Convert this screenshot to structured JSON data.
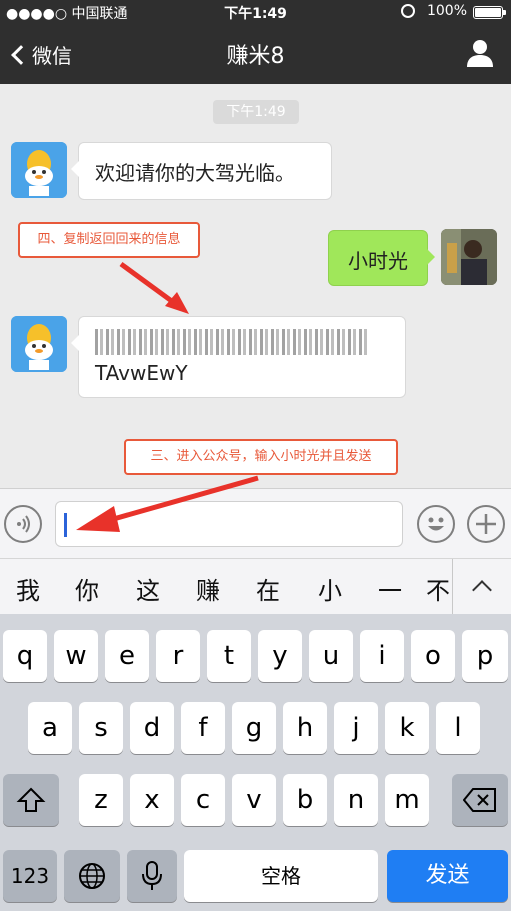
{
  "status": {
    "carrier": "●●●●○ 中国联通",
    "time": "下午1:49",
    "battery": "100%"
  },
  "nav": {
    "back_label": "微信",
    "title": "赚米8"
  },
  "chat": {
    "timestamp": "下午1:49",
    "messages": [
      {
        "from": "bot",
        "text": "欢迎请你的大驾光临。"
      },
      {
        "from": "me",
        "text": "小时光"
      },
      {
        "from": "bot",
        "line1": "TAvwEwY"
      }
    ]
  },
  "annotations": {
    "step4": "四、复制返回回来的信息",
    "step3": "三、进入公众号，输入小时光并且发送"
  },
  "suggestions": [
    "我",
    "你",
    "这",
    "赚",
    "在",
    "小",
    "一",
    "不"
  ],
  "keyboard": {
    "row1": [
      "q",
      "w",
      "e",
      "r",
      "t",
      "y",
      "u",
      "i",
      "o",
      "p"
    ],
    "row2": [
      "a",
      "s",
      "d",
      "f",
      "g",
      "h",
      "j",
      "k",
      "l"
    ],
    "row3": [
      "z",
      "x",
      "c",
      "v",
      "b",
      "n",
      "m"
    ],
    "numbers_label": "123",
    "space_label": "空格",
    "send_label": "发送"
  },
  "colors": {
    "accent_annotation": "#e8593a",
    "send_key": "#1f7ef3",
    "my_bubble": "#a0e75a"
  }
}
